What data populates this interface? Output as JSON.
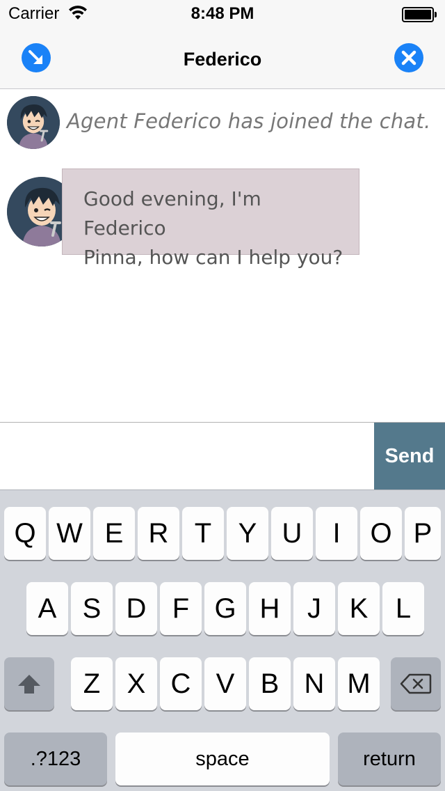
{
  "status_bar": {
    "carrier": "Carrier",
    "time": "8:48 PM",
    "icons": [
      "wifi-icon",
      "battery-icon"
    ]
  },
  "nav": {
    "title": "Federico",
    "left_icon": "minimize-arrow-icon",
    "right_icon": "close-icon",
    "accent_color": "#1a82f7"
  },
  "chat": {
    "system_message": "Agent Federico has joined the chat.",
    "messages": [
      {
        "sender": "Federico",
        "lines": [
          "Good evening, I'm Federico",
          "Pinna, how can I help you?"
        ]
      }
    ],
    "bubble_color": "#dcd1d6"
  },
  "composer": {
    "input_value": "",
    "send_label": "Send",
    "send_color": "#54798c"
  },
  "keyboard": {
    "row1": [
      "Q",
      "W",
      "E",
      "R",
      "T",
      "Y",
      "U",
      "I",
      "O",
      "P"
    ],
    "row2": [
      "A",
      "S",
      "D",
      "F",
      "G",
      "H",
      "J",
      "K",
      "L"
    ],
    "row3": [
      "Z",
      "X",
      "C",
      "V",
      "B",
      "N",
      "M"
    ],
    "shift_icon": "shift-icon",
    "delete_icon": "backspace-icon",
    "numbers_label": ".?123",
    "space_label": "space",
    "return_label": "return"
  }
}
